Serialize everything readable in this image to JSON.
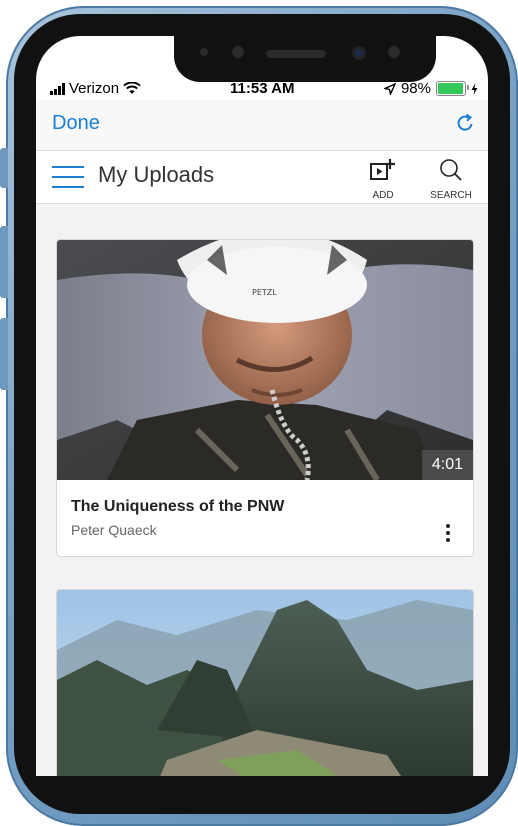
{
  "status_bar": {
    "carrier": "Verizon",
    "time": "11:53 AM",
    "battery": "98%",
    "battery_level": 0.98
  },
  "nav": {
    "done_label": "Done",
    "refresh_icon": "refresh-icon"
  },
  "header": {
    "title": "My Uploads",
    "add_label": "ADD",
    "search_label": "SEARCH"
  },
  "videos": [
    {
      "title": "The Uniqueness of the PNW",
      "author": "Peter Quaeck",
      "duration": "4:01",
      "helmet_text": "PETZL"
    },
    {
      "title": "",
      "author": "",
      "duration": ""
    }
  ],
  "colors": {
    "accent": "#1a7fd4",
    "battery": "#34c759",
    "frame": "#7aa3c6"
  }
}
